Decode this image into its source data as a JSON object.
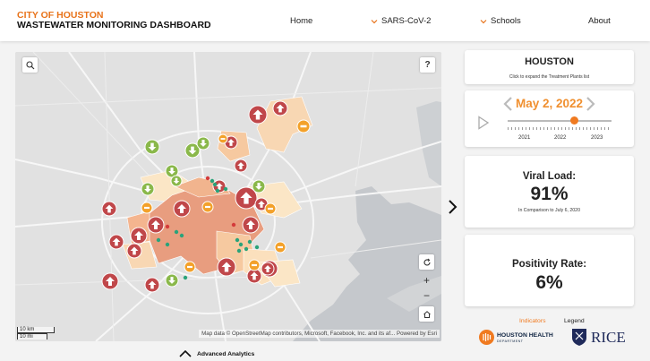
{
  "header": {
    "brand_line1": "CITY OF HOUSTON",
    "brand_line2": "WASTEWATER MONITORING DASHBOARD",
    "nav": {
      "home": "Home",
      "sars": "SARS-CoV-2",
      "schools": "Schools",
      "about": "About"
    }
  },
  "map": {
    "search_icon": "search-icon",
    "help_label": "?",
    "zoom_in": "+",
    "zoom_out": "−",
    "attribution": "Map data © OpenStreetMap contributors, Microsoft, Facebook, Inc. and its af...   Powered by Esri",
    "scale_km": "10 km",
    "scale_mi": "10 mi"
  },
  "location": {
    "title": "HOUSTON",
    "subtitle": "Click to expand the Treatment Plants list"
  },
  "timeline": {
    "date": "May 2, 2022",
    "years": [
      "2021",
      "2022",
      "2023"
    ]
  },
  "viral_load": {
    "title": "Viral Load:",
    "value": "91%",
    "subtitle": "In Comparison to July 6, 2020"
  },
  "positivity": {
    "title": "Positivity Rate:",
    "value": "6%"
  },
  "footer": {
    "indicators": "Indicators",
    "legend": "Legend",
    "hh_name": "HOUSTON HEALTH",
    "hh_dept": "DEPARTMENT",
    "rice": "RICE",
    "advanced": "Advanced Analytics"
  },
  "colors": {
    "accent": "#e8731a",
    "increase": "#c0474a",
    "decrease": "#8ab84a",
    "steady": "#f3a12a"
  }
}
